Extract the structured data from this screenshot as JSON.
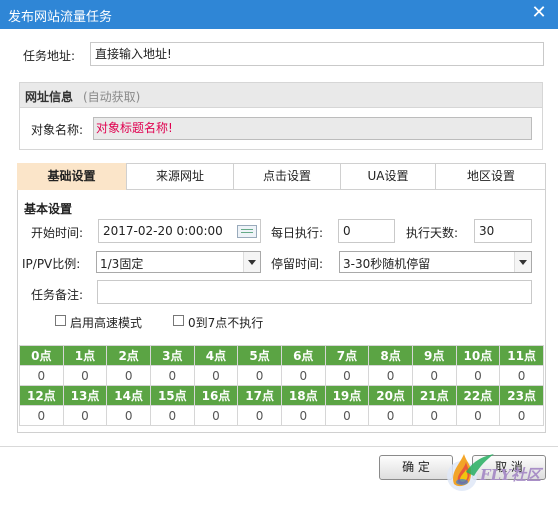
{
  "window": {
    "title": "发布网站流量任务",
    "close_label": "✕"
  },
  "task": {
    "address_label": "任务地址:",
    "address_value": "直接输入地址!"
  },
  "url_info": {
    "title": "网址信息",
    "subtitle": "(自动获取)",
    "object_label": "对象名称:",
    "object_value": "对象标题名称!"
  },
  "tabs": [
    "基础设置",
    "来源网址",
    "点击设置",
    "UA设置",
    "地区设置"
  ],
  "active_tab": "基础设置",
  "basic": {
    "heading": "基本设置",
    "start_label": "开始时间:",
    "start_value": "2017-02-20 0:00:00",
    "daily_label": "每日执行:",
    "daily_value": "0",
    "days_label": "执行天数:",
    "days_value": "30",
    "ratio_label": "IP/PV比例:",
    "ratio_value": "1/3固定",
    "stay_label": "停留时间:",
    "stay_value": "3-30秒随机停留",
    "note_label": "任务备注:",
    "note_value": "",
    "opt_fast": "启用高速模式",
    "opt_fast_checked": false,
    "opt_night": "0到7点不执行",
    "opt_night_checked": false
  },
  "hours": {
    "row1": [
      "0点",
      "1点",
      "2点",
      "3点",
      "4点",
      "5点",
      "6点",
      "7点",
      "8点",
      "9点",
      "10点",
      "11点"
    ],
    "values1": [
      "0",
      "0",
      "0",
      "0",
      "0",
      "0",
      "0",
      "0",
      "0",
      "0",
      "0",
      "0"
    ],
    "row2": [
      "12点",
      "13点",
      "14点",
      "15点",
      "16点",
      "17点",
      "18点",
      "19点",
      "20点",
      "21点",
      "22点",
      "23点"
    ],
    "values2": [
      "0",
      "0",
      "0",
      "0",
      "0",
      "0",
      "0",
      "0",
      "0",
      "0",
      "0",
      "0"
    ]
  },
  "buttons": {
    "ok": "确 定",
    "cancel": "取 消"
  },
  "watermark": "FLY社区",
  "colors": {
    "titlebar": "#2f86d6",
    "active_tab": "#fbe5c9",
    "hour_header": "#5ba444",
    "object_text": "#e0004f"
  }
}
